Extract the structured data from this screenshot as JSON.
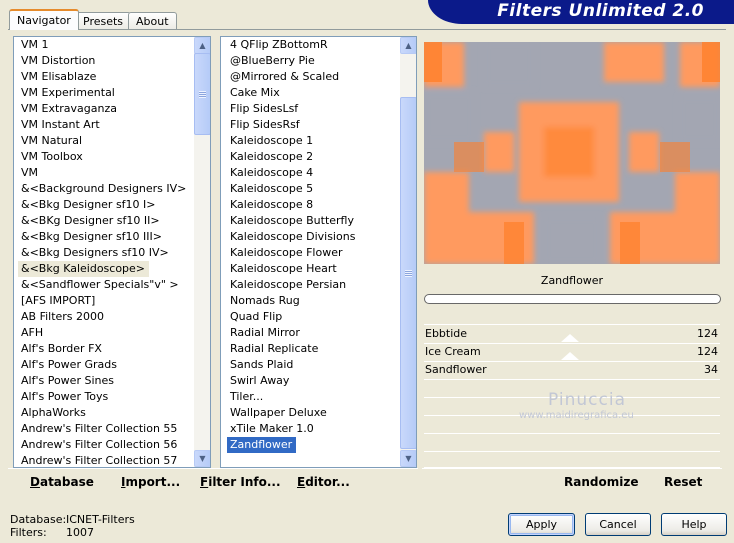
{
  "tabs": [
    {
      "label": "Navigator",
      "active": true
    },
    {
      "label": "Presets",
      "active": false
    },
    {
      "label": "About",
      "active": false
    }
  ],
  "banner": {
    "title": "Filters Unlimited 2.0"
  },
  "categories": {
    "items": [
      "VM 1",
      "VM Distortion",
      "VM Elisablaze",
      "VM Experimental",
      "VM Extravaganza",
      "VM Instant Art",
      "VM Natural",
      "VM Toolbox",
      "VM",
      "&<Background Designers IV>",
      "&<Bkg Designer sf10 I>",
      "&<BKg Designer sf10 II>",
      "&<Bkg Designer sf10 III>",
      "&<Bkg Designers sf10 IV>",
      "&<Bkg Kaleidoscope>",
      "&<Sandflower Specials\"v\" >",
      "[AFS IMPORT]",
      "AB Filters 2000",
      "AFH",
      "Alf's Border FX",
      "Alf's Power Grads",
      "Alf's Power Sines",
      "Alf's Power Toys",
      "AlphaWorks",
      "Andrew's Filter Collection 55",
      "Andrew's Filter Collection 56",
      "Andrew's Filter Collection 57"
    ],
    "selected_index": 14
  },
  "filters": {
    "items": [
      "4 QFlip ZBottomR",
      "@BlueBerry Pie",
      "@Mirrored & Scaled",
      "Cake Mix",
      "Flip SidesLsf",
      "Flip SidesRsf",
      "Kaleidoscope 1",
      "Kaleidoscope 2",
      "Kaleidoscope 4",
      "Kaleidoscope 5",
      "Kaleidoscope 8",
      "Kaleidoscope Butterfly",
      "Kaleidoscope Divisions",
      "Kaleidoscope Flower",
      "Kaleidoscope Heart",
      "Kaleidoscope Persian",
      "Nomads Rug",
      "Quad Flip",
      "Radial Mirror",
      "Radial Replicate",
      "Sands Plaid",
      "Swirl Away",
      "Tiler...",
      "Wallpaper Deluxe",
      "xTile Maker 1.0",
      "Zandflower"
    ],
    "selected_index": 25
  },
  "preview": {
    "colors": {
      "orange": "#ff9a5e",
      "deep_orange": "#ff7f2a",
      "gray": "#a3a6b2"
    }
  },
  "current_filter": {
    "name": "Zandflower"
  },
  "parameters": [
    {
      "label": "Ebbtide",
      "value": "124"
    },
    {
      "label": "Ice Cream",
      "value": "124"
    },
    {
      "label": "Sandflower",
      "value": "34"
    }
  ],
  "watermark": {
    "line1": "Pinuccia",
    "line2": "www.maidiregrafica.eu"
  },
  "toolbar": {
    "database": "Database",
    "import": "Import...",
    "filter_info": "Filter Info...",
    "editor": "Editor...",
    "randomize": "Randomize",
    "reset": "Reset"
  },
  "status": {
    "database_label": "Database:",
    "database_value": "ICNET-Filters",
    "filters_label": "Filters:",
    "filters_value": "1007"
  },
  "dialog": {
    "apply": "Apply",
    "cancel": "Cancel",
    "help": "Help"
  }
}
